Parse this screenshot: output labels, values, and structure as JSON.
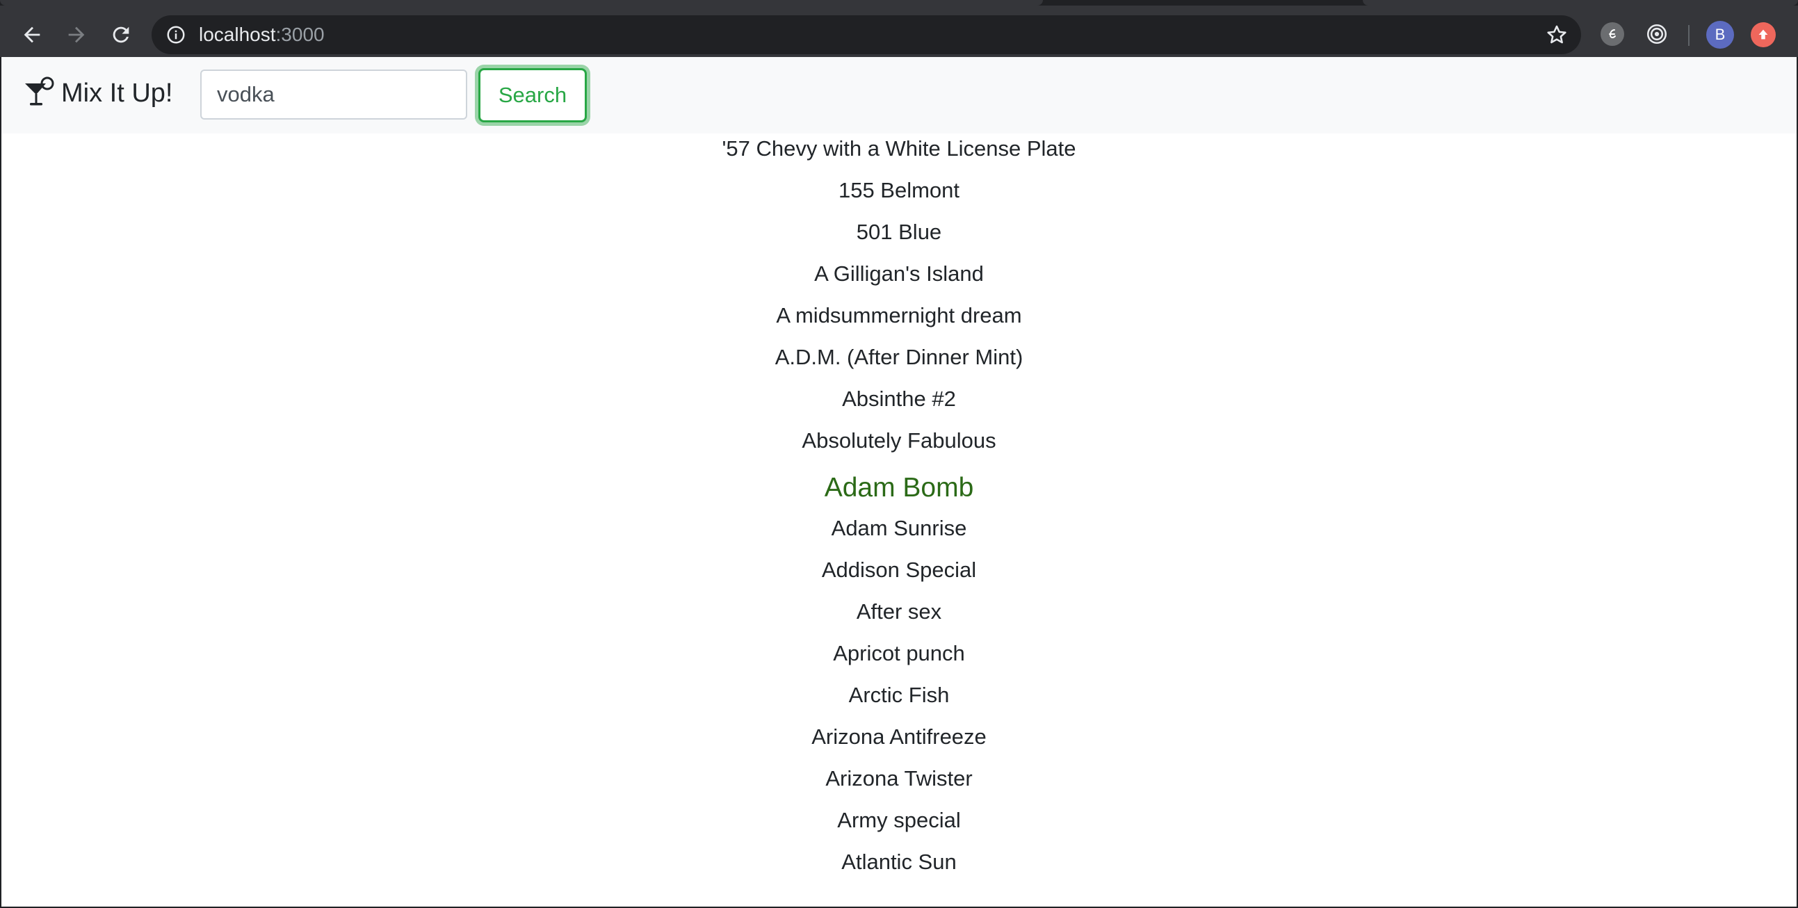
{
  "browser": {
    "url_host": "localhost",
    "url_port": ":3000",
    "avatar_letter": "B"
  },
  "navbar": {
    "brand": "Mix It Up!",
    "search_value": "vodka",
    "search_button": "Search"
  },
  "colors": {
    "accent_green": "#28a745",
    "hover_green": "#2b6a17",
    "navbar_bg": "#f8f9fa"
  },
  "results": [
    "'57 Chevy with a White License Plate",
    "155 Belmont",
    "501 Blue",
    "A Gilligan's Island",
    "A midsummernight dream",
    "A.D.M. (After Dinner Mint)",
    "Absinthe #2",
    "Absolutely Fabulous",
    "Adam Bomb",
    "Adam Sunrise",
    "Addison Special",
    "After sex",
    "Apricot punch",
    "Arctic Fish",
    "Arizona Antifreeze",
    "Arizona Twister",
    "Army special",
    "Atlantic Sun"
  ],
  "hovered_result": "Adam Bomb"
}
